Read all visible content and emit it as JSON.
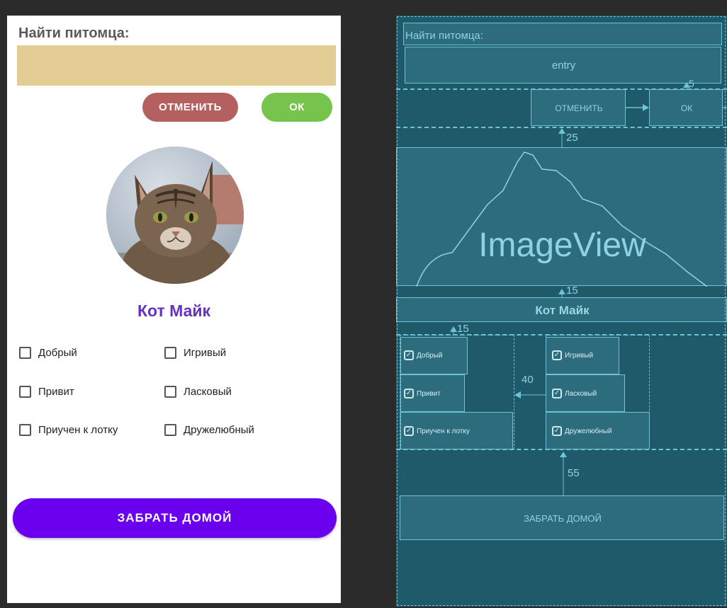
{
  "design": {
    "title": "Найти питомца:",
    "entry_value": "",
    "cancel_label": "ОТМЕНИТЬ",
    "ok_label": "ОК",
    "pet_name": "Кот Майк",
    "checkboxes": [
      {
        "label": "Добрый",
        "checked": false
      },
      {
        "label": "Игривый",
        "checked": false
      },
      {
        "label": "Привит",
        "checked": false
      },
      {
        "label": "Ласковый",
        "checked": false
      },
      {
        "label": "Приучен к лотку",
        "checked": false
      },
      {
        "label": "Дружелюбный",
        "checked": false
      }
    ],
    "take_home_label": "ЗАБРАТЬ ДОМОЙ",
    "colors": {
      "title": "#5a5a5a",
      "entry_bg": "#e4cd94",
      "cancel_bg": "#b46060",
      "ok_bg": "#77c44c",
      "pet_name": "#6531c2",
      "take_home_bg": "#6a00ee"
    }
  },
  "blueprint": {
    "title": "Найти питомца:",
    "entry_label": "entry",
    "cancel_label": "ОТМЕНИТЬ",
    "ok_label": "ОК",
    "image_label": "ImageView",
    "pet_name": "Кот Майк",
    "checkboxes": [
      "Добрый",
      "Игривый",
      "Привит",
      "Ласковый",
      "Приучен к лотку",
      "Дружелюбный"
    ],
    "take_home_label": "ЗАБРАТЬ ДОМОЙ",
    "margins": {
      "ok_top": "5",
      "image_top": "25",
      "name_top": "15",
      "checks_top": "15",
      "column_gap": "40",
      "button_top": "55"
    }
  }
}
